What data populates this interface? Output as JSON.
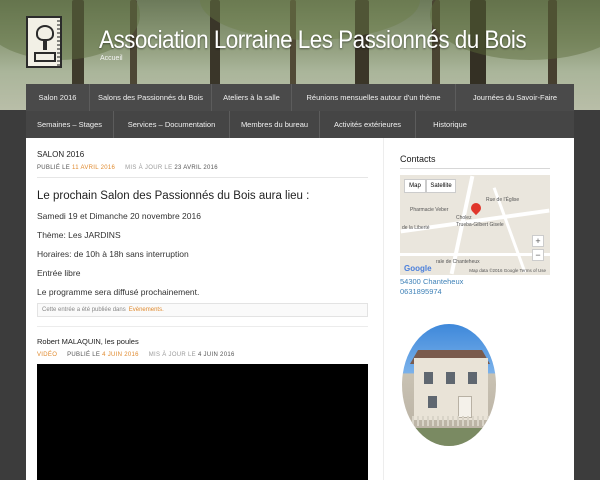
{
  "header": {
    "title": "Association Lorraine Les Passionnés du Bois",
    "tagline": "Accueil"
  },
  "nav": {
    "row1": [
      "Salon 2016",
      "Salons des Passionnés du Bois",
      "Ateliers à la salle",
      "Réunions mensuelles autour d'un thème",
      "Journées du Savoir-Faire"
    ],
    "row2": [
      "Semaines – Stages",
      "Services – Documentation",
      "Membres du bureau",
      "Activités extérieures",
      "Historique"
    ]
  },
  "post1": {
    "title": "SALON 2016",
    "meta_published_label": "PUBLIÉ LE",
    "meta_published_date": "11 AVRIL 2016",
    "meta_updated_label": "MIS À JOUR LE",
    "meta_updated_date": "23 AVRIL 2016",
    "headline": "Le prochain Salon des Passionnés du Bois aura lieu :",
    "paragraphs": [
      "Samedi 19 et Dimanche 20 novembre 2016",
      "Thème: Les JARDINS",
      "Horaires: de 10h à 18h sans interruption",
      "Entrée libre",
      "Le programme sera diffusé prochainement."
    ],
    "posted_in_label": "Cette entrée a été publiée dans",
    "posted_in_category": "Evènements."
  },
  "post2": {
    "title": "Robert MALAQUIN, les poules",
    "meta_category": "VIDÉO",
    "meta_published_label": "PUBLIÉ LE",
    "meta_published_date": "4 JUIN 2016",
    "meta_updated_label": "MIS À JOUR LE",
    "meta_updated_date": "4 JUIN 2016"
  },
  "sidebar": {
    "contacts_title": "Contacts",
    "map": {
      "btn_map": "Map",
      "btn_satellite": "Satellite",
      "label_rue_eglise": "Rue de l'Église",
      "label_pharmacie": "Pharmacie Veber",
      "label_liberte": "de la Liberté",
      "label_cholez": "Cholez",
      "label_trueba": "Trueba-Gilbert Gisele",
      "label_chanteheux": "rale de Chanteheux",
      "zoom_in": "+",
      "zoom_out": "−",
      "google": "Google",
      "attribution": "Map data ©2016 Google   Terms of Use"
    },
    "address": "54300 Chanteheux",
    "phone": "0631895974"
  },
  "colors": {
    "accent": "#e08a2e",
    "link": "#3f82b8",
    "nav_bg": "#4a4a4a"
  }
}
